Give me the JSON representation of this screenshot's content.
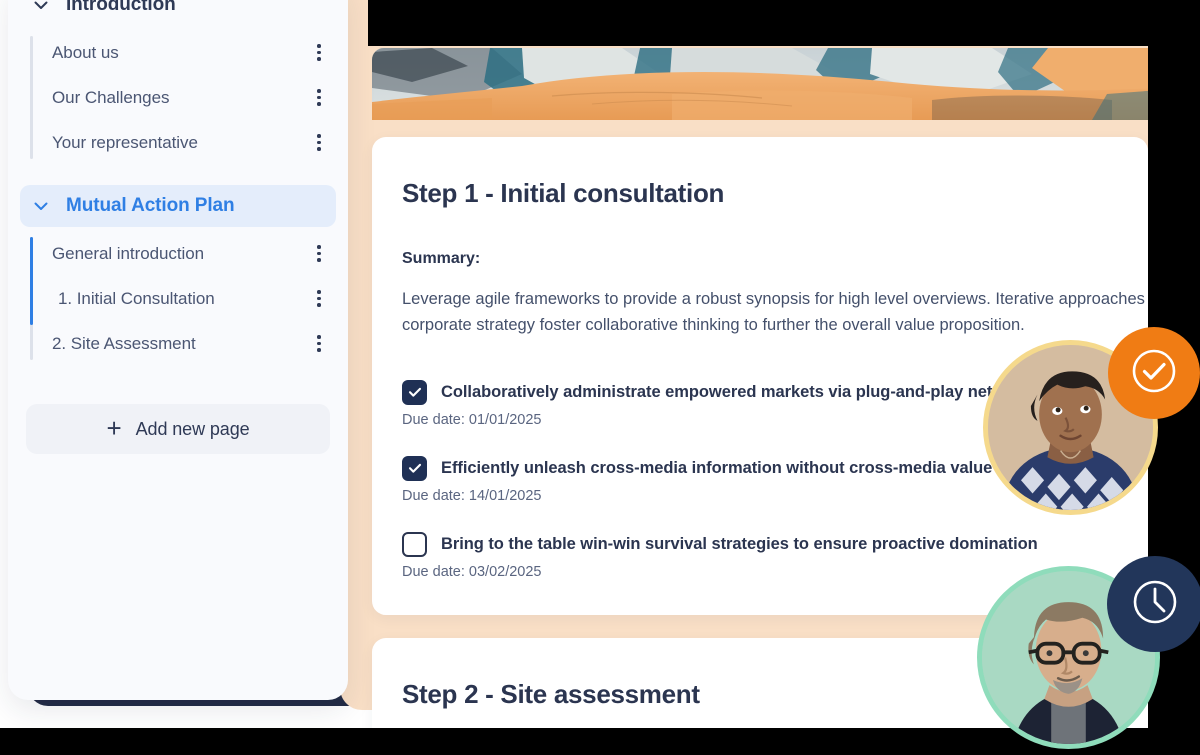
{
  "sidebar": {
    "sections": [
      {
        "label": "Introduction",
        "active": false,
        "chevron_icon": "chevron-down-icon",
        "pages": [
          {
            "name": "About us",
            "menu_icon": "kebab-menu-icon"
          },
          {
            "name": "Our Challenges",
            "menu_icon": "kebab-menu-icon"
          },
          {
            "name": "Your representative",
            "menu_icon": "kebab-menu-icon"
          }
        ]
      },
      {
        "label": "Mutual Action Plan",
        "active": true,
        "chevron_icon": "chevron-down-icon",
        "pages": [
          {
            "name": "General introduction",
            "menu_icon": "kebab-menu-icon"
          },
          {
            "name": "1. Initial Consultation",
            "menu_icon": "kebab-menu-icon"
          },
          {
            "name": "2. Site Assessment",
            "menu_icon": "kebab-menu-icon"
          }
        ]
      }
    ],
    "add_page": {
      "label": "Add new page",
      "plus_icon": "plus-icon",
      "plus_glyph": "+"
    }
  },
  "main": {
    "banner": {
      "alt": "abstract landscape header image"
    },
    "step1": {
      "title": "Step 1 - Initial consultation",
      "summary_label": "Summary:",
      "summary_line1": "Leverage agile frameworks to provide a robust synopsis for high level overviews. Iterative approaches to",
      "summary_line2": "corporate strategy foster collaborative thinking to further the overall value proposition.",
      "tasks": [
        {
          "checked": true,
          "text": "Collaboratively administrate empowered markets via plug-and-play networks",
          "due": "Due date: 01/01/2025"
        },
        {
          "checked": true,
          "text": "Efficiently unleash cross-media information without cross-media value",
          "due": "Due date: 14/01/2025"
        },
        {
          "checked": false,
          "text": "Bring to the table win-win survival strategies to ensure proactive domination",
          "due": "Due date: 03/02/2025"
        }
      ]
    },
    "step2": {
      "title": "Step 2 - Site assessment"
    }
  },
  "avatars": [
    {
      "name": "avatar-completed",
      "ring_color": "#F5D98C",
      "badge_icon": "check-circle-icon",
      "badge_color": "#F07C14",
      "status": "completed"
    },
    {
      "name": "avatar-pending",
      "ring_color": "#8FDCBB",
      "badge_icon": "clock-icon",
      "badge_color": "#22365A",
      "status": "pending"
    }
  ],
  "colors": {
    "peach_panel": "#F9DFC6",
    "navy_panel": "#222B45",
    "sidebar_bg": "#F9FAFD",
    "accent_blue": "#2F7FE4",
    "active_row_bg": "#E4EDFB",
    "heading": "#2B3550",
    "body_text": "#44506B",
    "checkbox_on": "#1F3055"
  }
}
